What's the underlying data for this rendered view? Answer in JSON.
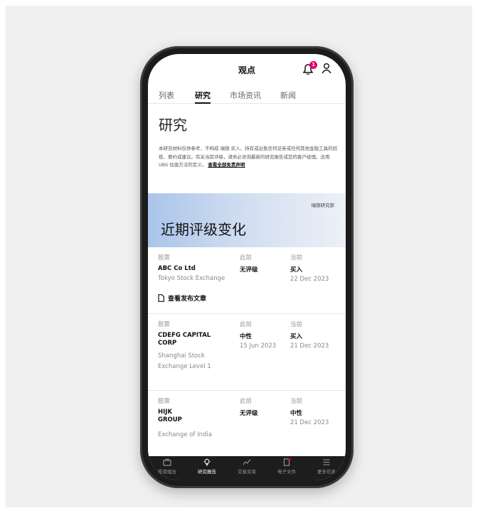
{
  "header": {
    "title": "观点",
    "notification_count": "1"
  },
  "tabs": [
    {
      "label": "列表"
    },
    {
      "label": "研究"
    },
    {
      "label": "市场资讯"
    },
    {
      "label": "新闻"
    }
  ],
  "page": {
    "title": "研究",
    "disclaimer": "本研究材料仅供参考，不构成 瑞银 买入、持有或出售任何证券或任何其他金融工具的招揽、要约或建议。有关当前评级，请务必咨询最新的研究报告或您的客户经理。适用 UBS 估值方法的定义。",
    "disclaimer_link": "查看全部免责声明"
  },
  "banner": {
    "department": "瑞银研究部",
    "headline": "近期评级变化"
  },
  "columns": {
    "stock": "股票",
    "previous": "此前",
    "current": "当前"
  },
  "rows": [
    {
      "name": "ABC Co Ltd",
      "exchange": "Tokyo Stock Exchange",
      "previous_rating": "无评级",
      "previous_date": "",
      "current_rating": "买入",
      "current_date": "22 Dec 2023",
      "article_link": "查看发布文章"
    },
    {
      "name": "CDEFG CAPITAL CORP",
      "exchange": "Shanghai Stock Exchange Level 1",
      "previous_rating": "中性",
      "previous_date": "15 Jun 2023",
      "current_rating": "买入",
      "current_date": "21 Dec 2023"
    },
    {
      "name": "HIJK GROUP",
      "exchange": "Exchange of India",
      "previous_rating": "无评级",
      "previous_date": "",
      "current_rating": "中性",
      "current_date": "21 Dec 2023"
    }
  ],
  "bottom_nav": [
    {
      "label": "投资组合",
      "icon": "briefcase-icon"
    },
    {
      "label": "研究报告",
      "icon": "lightbulb-icon"
    },
    {
      "label": "交易买卖",
      "icon": "chart-line-icon"
    },
    {
      "label": "电子文件",
      "icon": "document-icon"
    },
    {
      "label": "更多信息",
      "icon": "menu-icon"
    }
  ],
  "colors": {
    "accent": "#e0006e",
    "banner_start": "#a9c5ea",
    "nav_bg": "#1d1d1d"
  }
}
